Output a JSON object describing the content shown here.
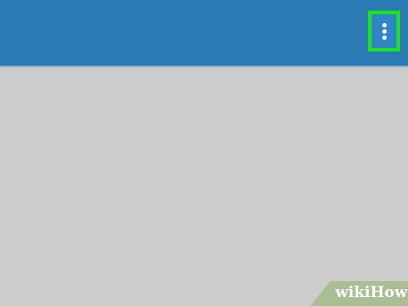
{
  "top_bar": {
    "color": "#2a7ab4",
    "menu_button": {
      "icon": "more-vertical-icon",
      "highlight_color": "#19e619"
    }
  },
  "content": {
    "background": "#cccccc"
  },
  "watermark": {
    "text": "wikiHow"
  }
}
